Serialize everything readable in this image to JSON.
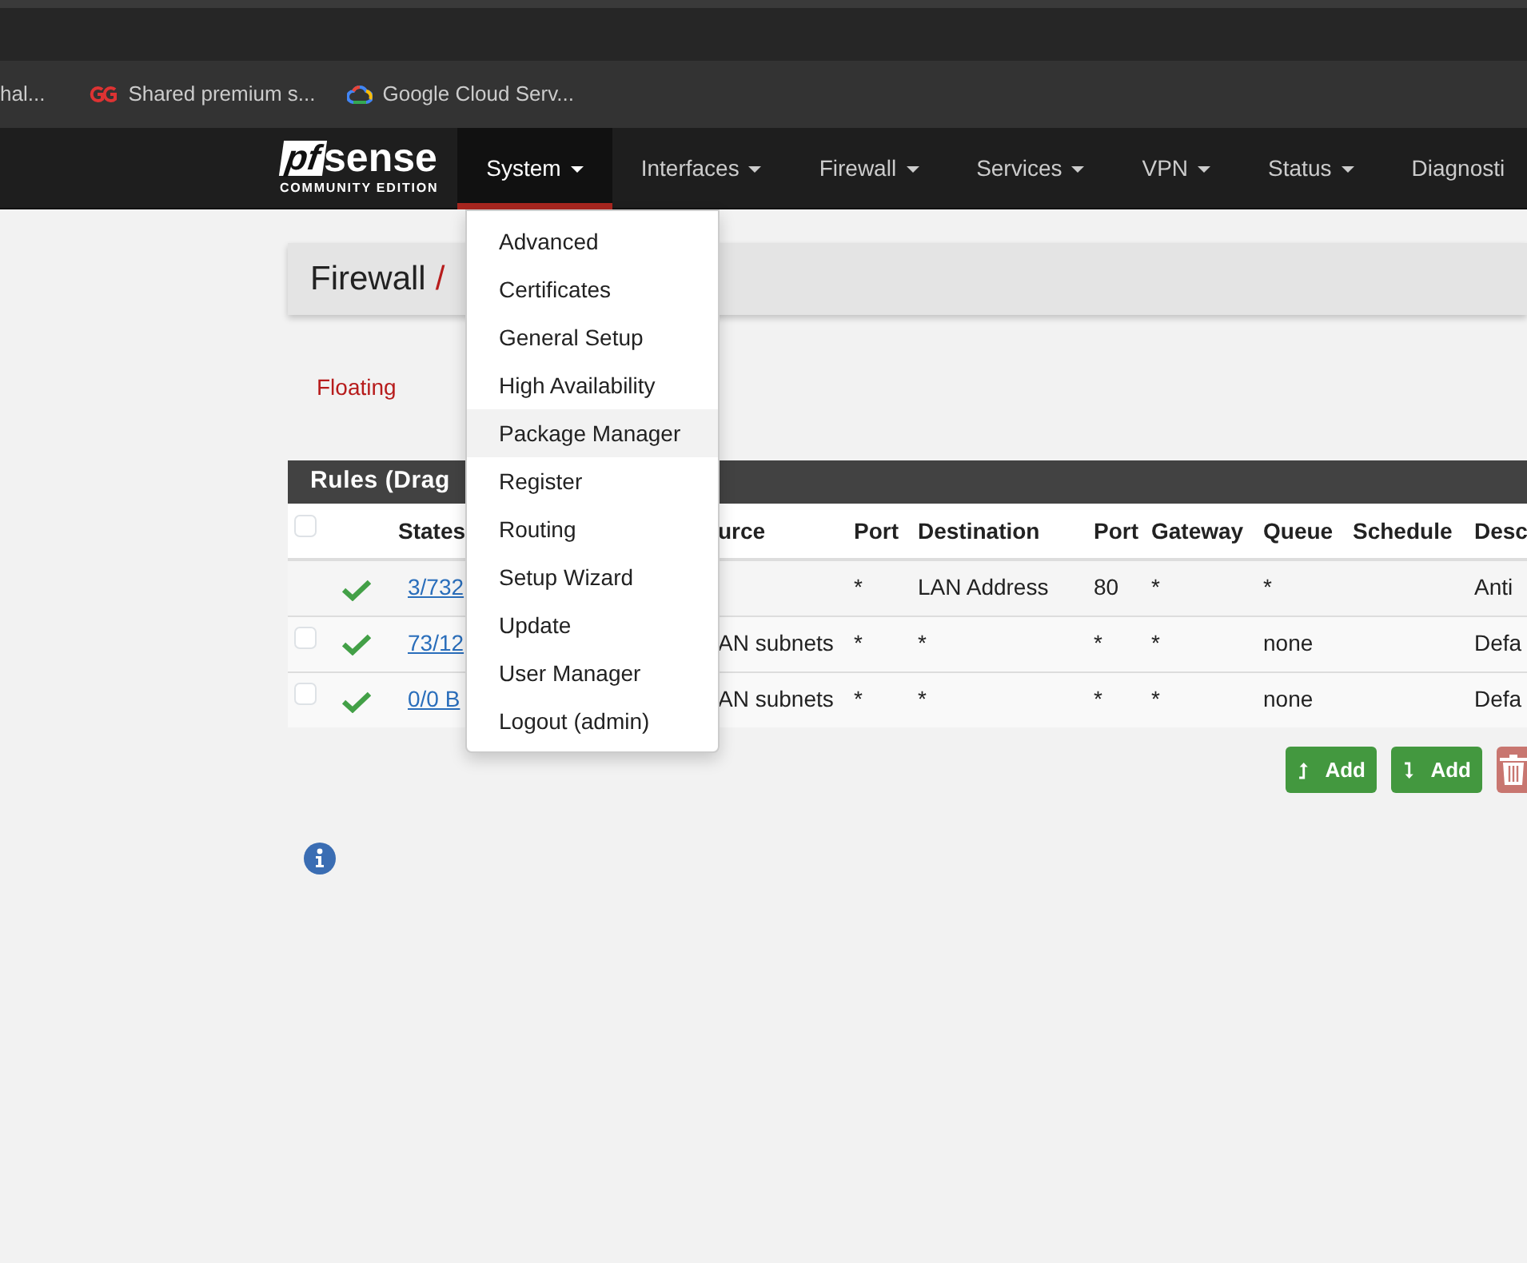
{
  "browser": {
    "bookmarks": [
      {
        "kind": "plain",
        "label": "hal..."
      },
      {
        "kind": "gg",
        "label": "Shared premium s..."
      },
      {
        "kind": "cloud",
        "label": "Google Cloud Serv..."
      }
    ]
  },
  "navbar": {
    "logo": {
      "mark": "pf",
      "word": "sense",
      "tagline": "COMMUNITY EDITION"
    },
    "menu": [
      {
        "label": "System",
        "caret": true,
        "selected": true
      },
      {
        "label": "Interfaces",
        "caret": true,
        "selected": false
      },
      {
        "label": "Firewall",
        "caret": true,
        "selected": false
      },
      {
        "label": "Services",
        "caret": true,
        "selected": false
      },
      {
        "label": "VPN",
        "caret": true,
        "selected": false
      },
      {
        "label": "Status",
        "caret": true,
        "selected": false
      },
      {
        "label": "Diagnosti",
        "caret": false,
        "selected": false
      }
    ]
  },
  "dropdown": {
    "items": [
      {
        "label": "Advanced",
        "selected": false
      },
      {
        "label": "Certificates",
        "selected": false
      },
      {
        "label": "General Setup",
        "selected": false
      },
      {
        "label": "High Availability",
        "selected": false
      },
      {
        "label": "Package Manager",
        "selected": true
      },
      {
        "label": "Register",
        "selected": false
      },
      {
        "label": "Routing",
        "selected": false
      },
      {
        "label": "Setup Wizard",
        "selected": false
      },
      {
        "label": "Update",
        "selected": false
      },
      {
        "label": "User Manager",
        "selected": false
      },
      {
        "label": "Logout (admin)",
        "selected": false
      }
    ]
  },
  "breadcrumb": {
    "section": "Firewall",
    "separator": "/"
  },
  "tabs": [
    {
      "label": "Floating",
      "selected": false
    }
  ],
  "rules": {
    "title": "Rules (Drag",
    "select_all_checked": false,
    "columns": [
      "States",
      "urce",
      "Port",
      "Destination",
      "Port",
      "Gateway",
      "Queue",
      "Schedule",
      "Desc"
    ],
    "rows": [
      {
        "selectable": false,
        "enabled": true,
        "cells": [
          "3/732",
          null,
          "*",
          "LAN Address",
          "80",
          "*",
          "*",
          null,
          "Anti"
        ]
      },
      {
        "selectable": true,
        "checked": false,
        "enabled": true,
        "cells": [
          "73/12",
          "AN subnets",
          "*",
          "*",
          "*",
          "*",
          "none",
          null,
          "Defa"
        ]
      },
      {
        "selectable": true,
        "checked": false,
        "enabled": true,
        "cells": [
          "0/0 B",
          "AN subnets",
          "*",
          "*",
          "*",
          "*",
          "none",
          null,
          "Defa"
        ]
      }
    ]
  },
  "actions": [
    {
      "kind": "add-top",
      "label": "Add"
    },
    {
      "kind": "add-bottom",
      "label": "Add"
    },
    {
      "kind": "delete"
    }
  ],
  "info": {
    "kind": "info"
  }
}
